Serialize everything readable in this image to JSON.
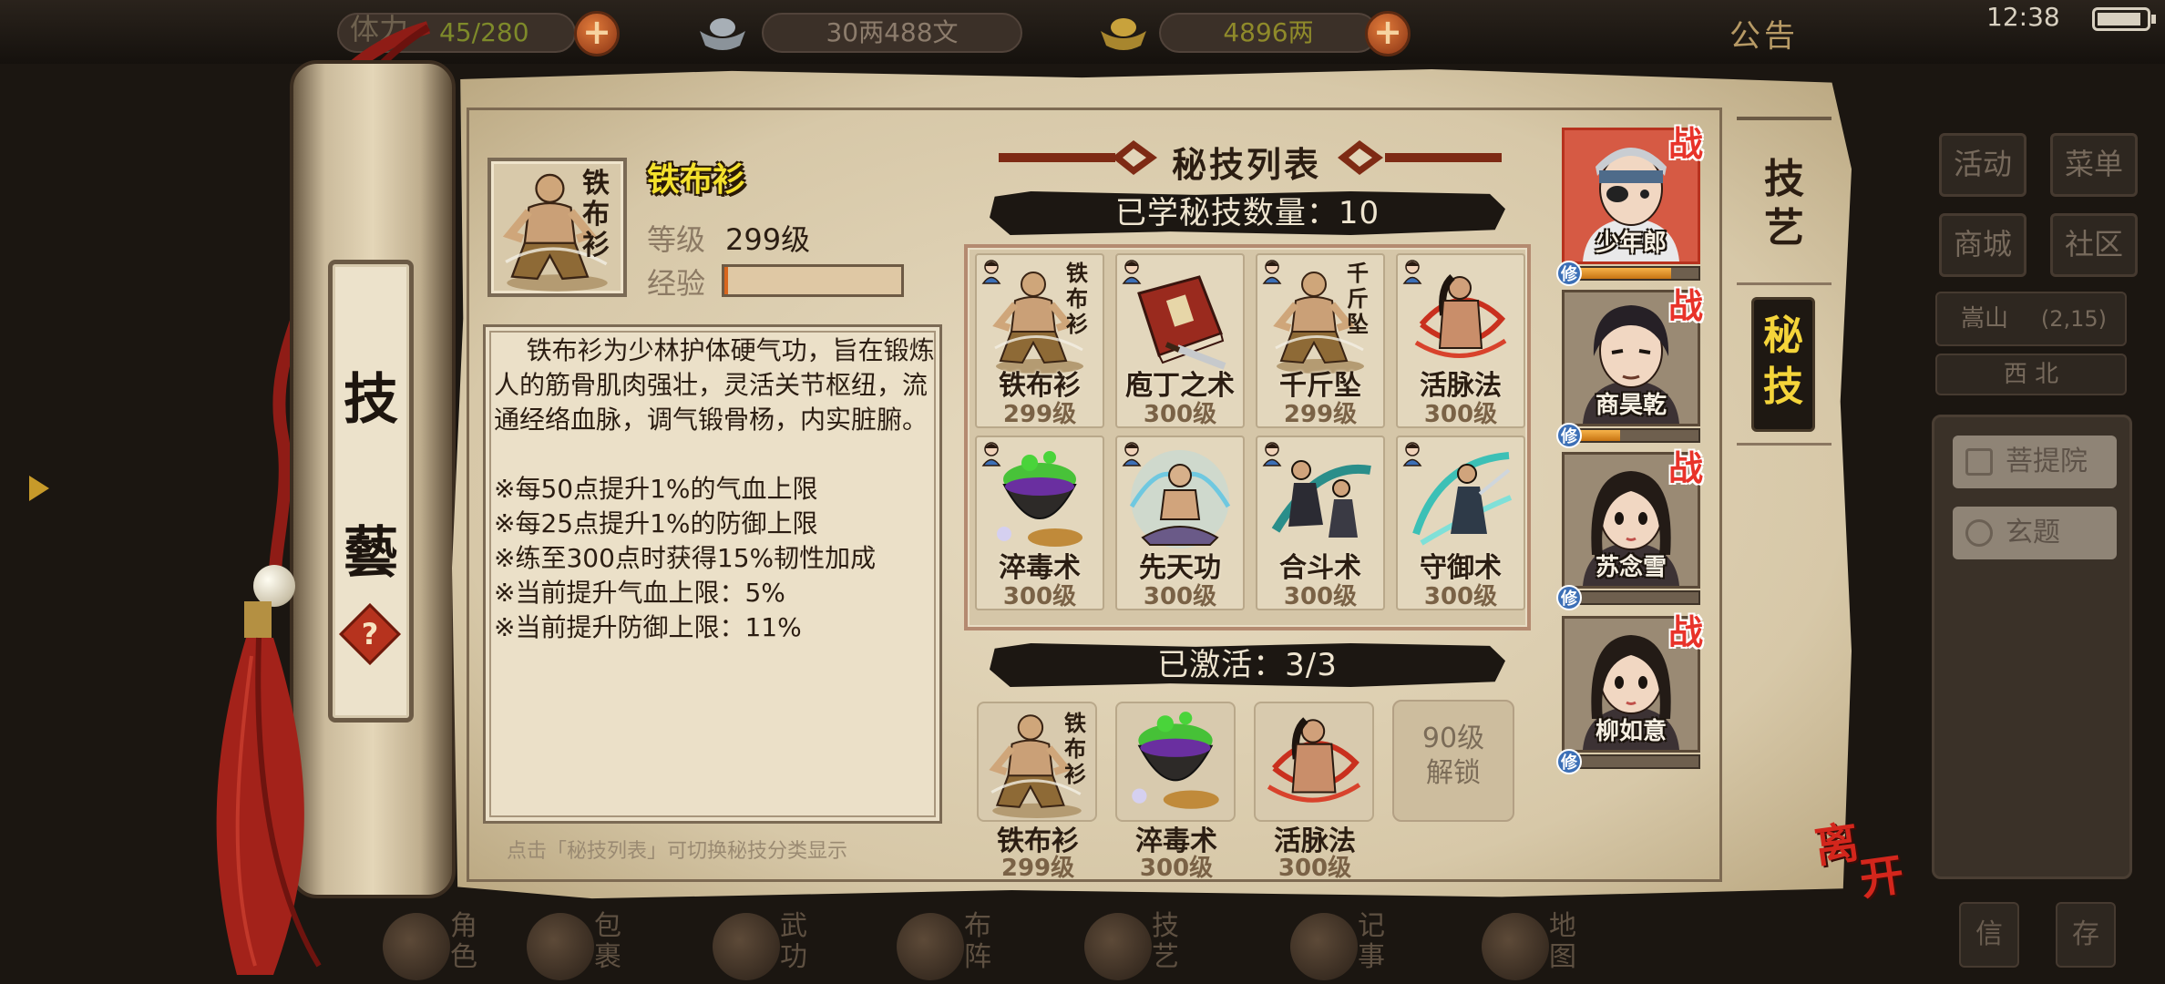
{
  "status_bar": {
    "time": "12:38",
    "battery_level": 0.9
  },
  "top_bar": {
    "stamina": "45/280",
    "stamina_partial_label": "体力",
    "silver": "30两488文",
    "gold": "4896两",
    "announcement": "公告"
  },
  "right_menu": {
    "buttons": [
      "活动",
      "菜单",
      "商城",
      "社区"
    ],
    "location": {
      "name": "嵩山",
      "coords": "(2,15)"
    },
    "direction": "西 北",
    "places": [
      "菩提院",
      "玄题"
    ],
    "bottom": [
      "信",
      "存"
    ]
  },
  "bottom_nav": [
    "角色",
    "包裹",
    "武功",
    "布阵",
    "技艺",
    "记事",
    "地图"
  ],
  "scroll": {
    "label_top": "技",
    "label_bottom": "藝",
    "help_symbol": "?"
  },
  "selected_skill": {
    "name": "铁布衫",
    "icon_calligraphy": "铁布衫",
    "level_label": "等级",
    "level_value": "299级",
    "exp_label": "经验",
    "exp_fraction": 0.02,
    "description": "    铁布衫为少林护体硬气功，旨在锻炼人的筋骨肌肉强壮，灵活关节枢纽，流通经络血脉，调气锻骨杨，内实脏腑。\n\n※每50点提升1%的气血上限\n※每25点提升1%的防御上限\n※练至300点时获得15%韧性加成\n※当前提升气血上限：5%\n※当前提升防御上限：11%"
  },
  "footer_hint": "点击「秘技列表」可切换秘技分类显示",
  "skill_list": {
    "title": "秘技列表",
    "learned_count_label": "已学秘技数量：10",
    "skills": [
      {
        "name": "铁布衫",
        "level": "299级",
        "art": "monk",
        "callig": "铁布衫"
      },
      {
        "name": "庖丁之术",
        "level": "300级",
        "art": "book",
        "callig": ""
      },
      {
        "name": "千斤坠",
        "level": "299级",
        "art": "monk",
        "callig": "千斤坠"
      },
      {
        "name": "活脉法",
        "level": "300级",
        "art": "fighter",
        "callig": ""
      },
      {
        "name": "淬毒术",
        "level": "300级",
        "art": "cauldron",
        "callig": ""
      },
      {
        "name": "先天功",
        "level": "300级",
        "art": "meditate",
        "callig": ""
      },
      {
        "name": "合斗术",
        "level": "300级",
        "art": "dual",
        "callig": ""
      },
      {
        "name": "守御术",
        "level": "300级",
        "art": "sword",
        "callig": ""
      }
    ]
  },
  "active": {
    "label": "已激活：3/3",
    "skills": [
      {
        "name": "铁布衫",
        "level": "299级",
        "art": "monk",
        "callig": "铁布衫"
      },
      {
        "name": "淬毒术",
        "level": "300级",
        "art": "cauldron",
        "callig": ""
      },
      {
        "name": "活脉法",
        "level": "300级",
        "art": "fighter",
        "callig": ""
      }
    ],
    "locked_label_1": "90级",
    "locked_label_2": "解锁"
  },
  "characters": [
    {
      "name": "少年郎",
      "tag": "战",
      "cultivation_tag": "修",
      "cultivation_fraction": 0.8,
      "selected": true,
      "hair": "#c9cdd2"
    },
    {
      "name": "商昊乾",
      "tag": "战",
      "cultivation_tag": "修",
      "cultivation_fraction": 0.42,
      "selected": false,
      "hair": "#262026"
    },
    {
      "name": "苏念雪",
      "tag": "战",
      "cultivation_tag": "修",
      "cultivation_fraction": 0.0,
      "selected": false,
      "hair": "#231b16"
    },
    {
      "name": "柳如意",
      "tag": "战",
      "cultivation_tag": "修",
      "cultivation_fraction": 0.08,
      "selected": false,
      "hair": "#231b16"
    }
  ],
  "side_tabs": {
    "tab1": "技艺",
    "tab2": "秘技",
    "tab1_top": "技",
    "tab1_bottom": "艺",
    "tab2_top": "秘",
    "tab2_bottom": "技"
  },
  "leave_button": {
    "line1": "离",
    "line2": "开"
  },
  "colors": {
    "accent_red": "#b7321e",
    "name_yellow": "#f4e12c",
    "tab_active_text": "#f4d43a",
    "exp_fill": "#d8661e"
  }
}
